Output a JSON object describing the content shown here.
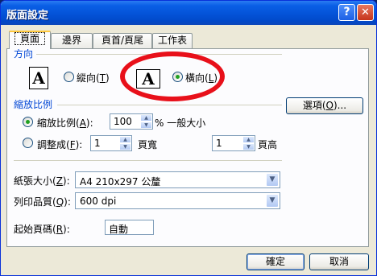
{
  "window": {
    "title": "版面設定",
    "help_label": "?",
    "close_label": "✕"
  },
  "tabs": [
    {
      "label": "頁面",
      "active": true
    },
    {
      "label": "邊界",
      "active": false
    },
    {
      "label": "頁首/頁尾",
      "active": false
    },
    {
      "label": "工作表",
      "active": false
    }
  ],
  "orientation": {
    "section_title": "方向",
    "portrait_glyph": "A",
    "landscape_glyph": "A",
    "portrait_label": "縱向(",
    "portrait_key": "T",
    "landscape_label": "橫向(",
    "landscape_key": "L",
    "close_paren": ")",
    "selected": "landscape"
  },
  "scaling": {
    "section_title": "縮放比例",
    "adjust_label": "縮放比例(",
    "adjust_key": "A",
    "adjust_suffix": "):",
    "adjust_value": "100",
    "adjust_unit": "% 一般大小",
    "fit_label": "調整成(",
    "fit_key": "F",
    "fit_suffix": "):",
    "fit_wide_value": "1",
    "fit_wide_label": "頁寬",
    "fit_tall_value": "1",
    "fit_tall_label": "頁高",
    "selected": "adjust"
  },
  "options_button": {
    "label": "選項(",
    "key": "O",
    "suffix": ")..."
  },
  "paper_size": {
    "label": "紙張大小(",
    "key": "Z",
    "suffix": "):",
    "value": "A4 210x297 公釐"
  },
  "print_quality": {
    "label": "列印品質(",
    "key": "Q",
    "suffix": "):",
    "value": "600 dpi"
  },
  "first_page": {
    "label": "起始頁碼(",
    "key": "R",
    "suffix": "):",
    "value": "自動"
  },
  "footer": {
    "ok_label": "確定",
    "cancel_label": "取消"
  },
  "colors": {
    "titlebar": "#0453d8",
    "accent_circle": "#e8101a",
    "section_title": "#0046d5"
  }
}
